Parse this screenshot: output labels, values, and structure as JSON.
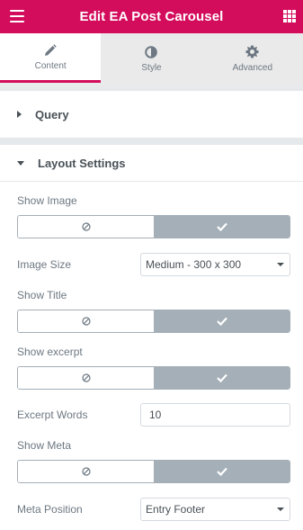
{
  "header": {
    "title": "Edit EA Post Carousel",
    "menu_icon": "hamburger-menu-icon",
    "grid_icon": "apps-grid-icon"
  },
  "tabs": [
    {
      "label": "Content",
      "icon": "pencil-icon",
      "active": true
    },
    {
      "label": "Style",
      "icon": "half-circle-icon",
      "active": false
    },
    {
      "label": "Advanced",
      "icon": "gear-icon",
      "active": false
    }
  ],
  "sections": {
    "query": {
      "title": "Query",
      "expanded": false
    },
    "layout": {
      "title": "Layout Settings",
      "expanded": true
    }
  },
  "controls": {
    "show_image": {
      "label": "Show Image",
      "value": "on"
    },
    "image_size": {
      "label": "Image Size",
      "value": "Medium - 300 x 300"
    },
    "show_title": {
      "label": "Show Title",
      "value": "on"
    },
    "show_excerpt": {
      "label": "Show excerpt",
      "value": "on"
    },
    "excerpt_words": {
      "label": "Excerpt Words",
      "value": "10"
    },
    "show_meta": {
      "label": "Show Meta",
      "value": "on"
    },
    "meta_position": {
      "label": "Meta Position",
      "value": "Entry Footer"
    }
  },
  "colors": {
    "brand": "#d30c5c",
    "switch_active": "#a4afb7",
    "text": "#6d7882"
  }
}
